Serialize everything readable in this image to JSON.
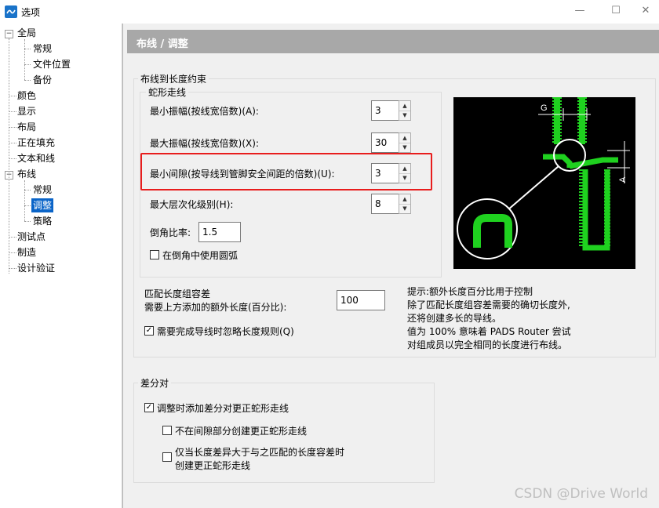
{
  "window": {
    "title": "选项",
    "min_glyph": "—",
    "max_glyph": "☐",
    "close_glyph": "✕"
  },
  "tree": {
    "items": [
      {
        "label": "全局"
      },
      {
        "label": "常规"
      },
      {
        "label": "文件位置"
      },
      {
        "label": "备份"
      },
      {
        "label": "颜色"
      },
      {
        "label": "显示"
      },
      {
        "label": "布局"
      },
      {
        "label": "正在填充"
      },
      {
        "label": "文本和线"
      },
      {
        "label": "布线"
      },
      {
        "label": "常规"
      },
      {
        "label": "调整"
      },
      {
        "label": "策略"
      },
      {
        "label": "测试点"
      },
      {
        "label": "制造"
      },
      {
        "label": "设计验证"
      }
    ],
    "selected_index": 11
  },
  "page": {
    "header": "布线 / 调整",
    "length_group_title": "布线到长度约束",
    "serpentine_group_title": "蛇形走线",
    "min_amplitude_label": "最小振幅(按线宽倍数)(A):",
    "min_amplitude_value": "3",
    "max_amplitude_label": "最大振幅(按线宽倍数)(X):",
    "max_amplitude_value": "30",
    "min_gap_label": "最小间隙(按导线到管脚安全间距的倍数)(U):",
    "min_gap_value": "3",
    "max_level_label": "最大层次化级别(H):",
    "max_level_value": "8",
    "chamfer_label": "倒角比率:",
    "chamfer_value": "1.5",
    "use_arc_label": "在倒角中使用圆弧",
    "use_arc_checked": false,
    "match_tolerance_title": "匹配长度组容差",
    "match_tolerance_label": "需要上方添加的额外长度(百分比):",
    "match_tolerance_value": "100",
    "ignore_rule_label": "需要完成导线时忽略长度规则(Q)",
    "ignore_rule_checked": true,
    "hint_lines": [
      "提示:额外长度百分比用于控制",
      "除了匹配长度组容差需要的确切长度外,",
      "还将创建多长的导线。",
      "值为 100% 意味着 PADS Router 尝试",
      "对组成员以完全相同的长度进行布线。"
    ],
    "diagram_labels": {
      "g": "G",
      "a": "A"
    },
    "diff_group_title": "差分对",
    "diff_add_label": "调整时添加差分对更正蛇形走线",
    "diff_add_checked": true,
    "diff_no_gap_label": "不在间隙部分创建更正蛇形走线",
    "diff_no_gap_checked": false,
    "diff_only_line1": "仅当长度差异大于与之匹配的长度容差时",
    "diff_only_line2": "创建更正蛇形走线",
    "diff_only_checked": false
  },
  "colors": {
    "accent_green": "#1fd11f",
    "highlight_red": "#e81d1d",
    "selection_blue": "#0a64c8"
  },
  "watermark": "CSDN @Drive World"
}
